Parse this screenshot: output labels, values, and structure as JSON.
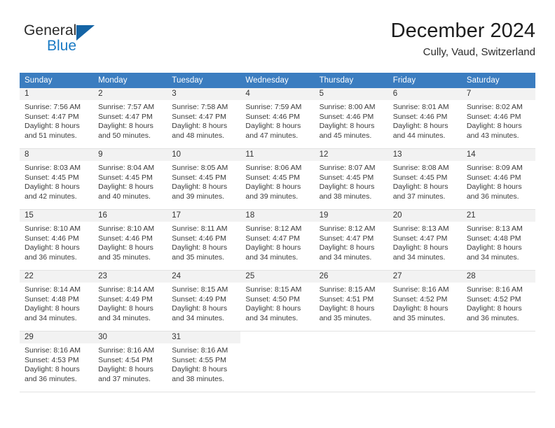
{
  "brand": {
    "name_top": "General",
    "name_bottom": "Blue",
    "triangle_color": "#1464a5",
    "blue_text_color": "#1a7ac4",
    "icon": "general-blue-logo"
  },
  "header": {
    "title": "December 2024",
    "subtitle": "Cully, Vaud, Switzerland"
  },
  "theme": {
    "header_bg": "#3b7dc0",
    "header_text": "#ffffff",
    "datebar_bg": "#f2f2f2",
    "cell_bg": "#ffffff",
    "separator": "#e2e2e2"
  },
  "weekday_headers": [
    "Sunday",
    "Monday",
    "Tuesday",
    "Wednesday",
    "Thursday",
    "Friday",
    "Saturday"
  ],
  "weeks": [
    [
      {
        "date": "1",
        "sunrise": "Sunrise: 7:56 AM",
        "sunset": "Sunset: 4:47 PM",
        "daylight1": "Daylight: 8 hours",
        "daylight2": "and 51 minutes."
      },
      {
        "date": "2",
        "sunrise": "Sunrise: 7:57 AM",
        "sunset": "Sunset: 4:47 PM",
        "daylight1": "Daylight: 8 hours",
        "daylight2": "and 50 minutes."
      },
      {
        "date": "3",
        "sunrise": "Sunrise: 7:58 AM",
        "sunset": "Sunset: 4:47 PM",
        "daylight1": "Daylight: 8 hours",
        "daylight2": "and 48 minutes."
      },
      {
        "date": "4",
        "sunrise": "Sunrise: 7:59 AM",
        "sunset": "Sunset: 4:46 PM",
        "daylight1": "Daylight: 8 hours",
        "daylight2": "and 47 minutes."
      },
      {
        "date": "5",
        "sunrise": "Sunrise: 8:00 AM",
        "sunset": "Sunset: 4:46 PM",
        "daylight1": "Daylight: 8 hours",
        "daylight2": "and 45 minutes."
      },
      {
        "date": "6",
        "sunrise": "Sunrise: 8:01 AM",
        "sunset": "Sunset: 4:46 PM",
        "daylight1": "Daylight: 8 hours",
        "daylight2": "and 44 minutes."
      },
      {
        "date": "7",
        "sunrise": "Sunrise: 8:02 AM",
        "sunset": "Sunset: 4:46 PM",
        "daylight1": "Daylight: 8 hours",
        "daylight2": "and 43 minutes."
      }
    ],
    [
      {
        "date": "8",
        "sunrise": "Sunrise: 8:03 AM",
        "sunset": "Sunset: 4:45 PM",
        "daylight1": "Daylight: 8 hours",
        "daylight2": "and 42 minutes."
      },
      {
        "date": "9",
        "sunrise": "Sunrise: 8:04 AM",
        "sunset": "Sunset: 4:45 PM",
        "daylight1": "Daylight: 8 hours",
        "daylight2": "and 40 minutes."
      },
      {
        "date": "10",
        "sunrise": "Sunrise: 8:05 AM",
        "sunset": "Sunset: 4:45 PM",
        "daylight1": "Daylight: 8 hours",
        "daylight2": "and 39 minutes."
      },
      {
        "date": "11",
        "sunrise": "Sunrise: 8:06 AM",
        "sunset": "Sunset: 4:45 PM",
        "daylight1": "Daylight: 8 hours",
        "daylight2": "and 39 minutes."
      },
      {
        "date": "12",
        "sunrise": "Sunrise: 8:07 AM",
        "sunset": "Sunset: 4:45 PM",
        "daylight1": "Daylight: 8 hours",
        "daylight2": "and 38 minutes."
      },
      {
        "date": "13",
        "sunrise": "Sunrise: 8:08 AM",
        "sunset": "Sunset: 4:45 PM",
        "daylight1": "Daylight: 8 hours",
        "daylight2": "and 37 minutes."
      },
      {
        "date": "14",
        "sunrise": "Sunrise: 8:09 AM",
        "sunset": "Sunset: 4:46 PM",
        "daylight1": "Daylight: 8 hours",
        "daylight2": "and 36 minutes."
      }
    ],
    [
      {
        "date": "15",
        "sunrise": "Sunrise: 8:10 AM",
        "sunset": "Sunset: 4:46 PM",
        "daylight1": "Daylight: 8 hours",
        "daylight2": "and 36 minutes."
      },
      {
        "date": "16",
        "sunrise": "Sunrise: 8:10 AM",
        "sunset": "Sunset: 4:46 PM",
        "daylight1": "Daylight: 8 hours",
        "daylight2": "and 35 minutes."
      },
      {
        "date": "17",
        "sunrise": "Sunrise: 8:11 AM",
        "sunset": "Sunset: 4:46 PM",
        "daylight1": "Daylight: 8 hours",
        "daylight2": "and 35 minutes."
      },
      {
        "date": "18",
        "sunrise": "Sunrise: 8:12 AM",
        "sunset": "Sunset: 4:47 PM",
        "daylight1": "Daylight: 8 hours",
        "daylight2": "and 34 minutes."
      },
      {
        "date": "19",
        "sunrise": "Sunrise: 8:12 AM",
        "sunset": "Sunset: 4:47 PM",
        "daylight1": "Daylight: 8 hours",
        "daylight2": "and 34 minutes."
      },
      {
        "date": "20",
        "sunrise": "Sunrise: 8:13 AM",
        "sunset": "Sunset: 4:47 PM",
        "daylight1": "Daylight: 8 hours",
        "daylight2": "and 34 minutes."
      },
      {
        "date": "21",
        "sunrise": "Sunrise: 8:13 AM",
        "sunset": "Sunset: 4:48 PM",
        "daylight1": "Daylight: 8 hours",
        "daylight2": "and 34 minutes."
      }
    ],
    [
      {
        "date": "22",
        "sunrise": "Sunrise: 8:14 AM",
        "sunset": "Sunset: 4:48 PM",
        "daylight1": "Daylight: 8 hours",
        "daylight2": "and 34 minutes."
      },
      {
        "date": "23",
        "sunrise": "Sunrise: 8:14 AM",
        "sunset": "Sunset: 4:49 PM",
        "daylight1": "Daylight: 8 hours",
        "daylight2": "and 34 minutes."
      },
      {
        "date": "24",
        "sunrise": "Sunrise: 8:15 AM",
        "sunset": "Sunset: 4:49 PM",
        "daylight1": "Daylight: 8 hours",
        "daylight2": "and 34 minutes."
      },
      {
        "date": "25",
        "sunrise": "Sunrise: 8:15 AM",
        "sunset": "Sunset: 4:50 PM",
        "daylight1": "Daylight: 8 hours",
        "daylight2": "and 34 minutes."
      },
      {
        "date": "26",
        "sunrise": "Sunrise: 8:15 AM",
        "sunset": "Sunset: 4:51 PM",
        "daylight1": "Daylight: 8 hours",
        "daylight2": "and 35 minutes."
      },
      {
        "date": "27",
        "sunrise": "Sunrise: 8:16 AM",
        "sunset": "Sunset: 4:52 PM",
        "daylight1": "Daylight: 8 hours",
        "daylight2": "and 35 minutes."
      },
      {
        "date": "28",
        "sunrise": "Sunrise: 8:16 AM",
        "sunset": "Sunset: 4:52 PM",
        "daylight1": "Daylight: 8 hours",
        "daylight2": "and 36 minutes."
      }
    ],
    [
      {
        "date": "29",
        "sunrise": "Sunrise: 8:16 AM",
        "sunset": "Sunset: 4:53 PM",
        "daylight1": "Daylight: 8 hours",
        "daylight2": "and 36 minutes."
      },
      {
        "date": "30",
        "sunrise": "Sunrise: 8:16 AM",
        "sunset": "Sunset: 4:54 PM",
        "daylight1": "Daylight: 8 hours",
        "daylight2": "and 37 minutes."
      },
      {
        "date": "31",
        "sunrise": "Sunrise: 8:16 AM",
        "sunset": "Sunset: 4:55 PM",
        "daylight1": "Daylight: 8 hours",
        "daylight2": "and 38 minutes."
      },
      {
        "date": "",
        "sunrise": "",
        "sunset": "",
        "daylight1": "",
        "daylight2": ""
      },
      {
        "date": "",
        "sunrise": "",
        "sunset": "",
        "daylight1": "",
        "daylight2": ""
      },
      {
        "date": "",
        "sunrise": "",
        "sunset": "",
        "daylight1": "",
        "daylight2": ""
      },
      {
        "date": "",
        "sunrise": "",
        "sunset": "",
        "daylight1": "",
        "daylight2": ""
      }
    ]
  ]
}
